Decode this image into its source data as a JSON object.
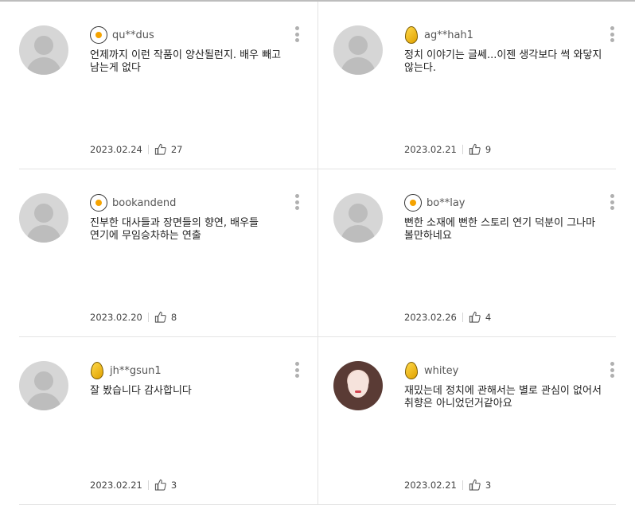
{
  "comments": [
    {
      "username": "qu**dus",
      "badge": "egg-badge-icon",
      "text": "언제까지 이런 작품이 양산될런지. 배우 빼고 남는게 없다",
      "date": "2023.02.24",
      "likes": "27",
      "avatar": "default"
    },
    {
      "username": "ag**hah1",
      "badge": "gold-egg-badge-icon",
      "text": "정치 이야기는 글쎄...이젠 생각보다 썩 와닿지 않는다.",
      "date": "2023.02.21",
      "likes": "9",
      "avatar": "default"
    },
    {
      "username": "bookandend",
      "badge": "egg-badge-icon",
      "text": "진부한 대사들과 장면들의 향연, 배우들 연기에 무임승차하는 연출",
      "date": "2023.02.20",
      "likes": "8",
      "avatar": "default"
    },
    {
      "username": "bo**lay",
      "badge": "egg-badge-icon",
      "text": "뻔한 소재에 뻔한 스토리 연기 덕분이 그나마 볼만하네요",
      "date": "2023.02.26",
      "likes": "4",
      "avatar": "default"
    },
    {
      "username": "jh**gsun1",
      "badge": "gold-egg-badge-icon",
      "text": "잘 봤습니다 감사합니다",
      "date": "2023.02.21",
      "likes": "3",
      "avatar": "default"
    },
    {
      "username": "whitey",
      "badge": "gold-egg-badge-icon",
      "text": "재밌는데 정치에 관해서는 별로 관심이 없어서 취향은 아니었던거같아요",
      "date": "2023.02.21",
      "likes": "3",
      "avatar": "photo"
    }
  ],
  "icons": {
    "thumb": "thumbs-up-icon",
    "menu": "more-vertical-icon"
  }
}
